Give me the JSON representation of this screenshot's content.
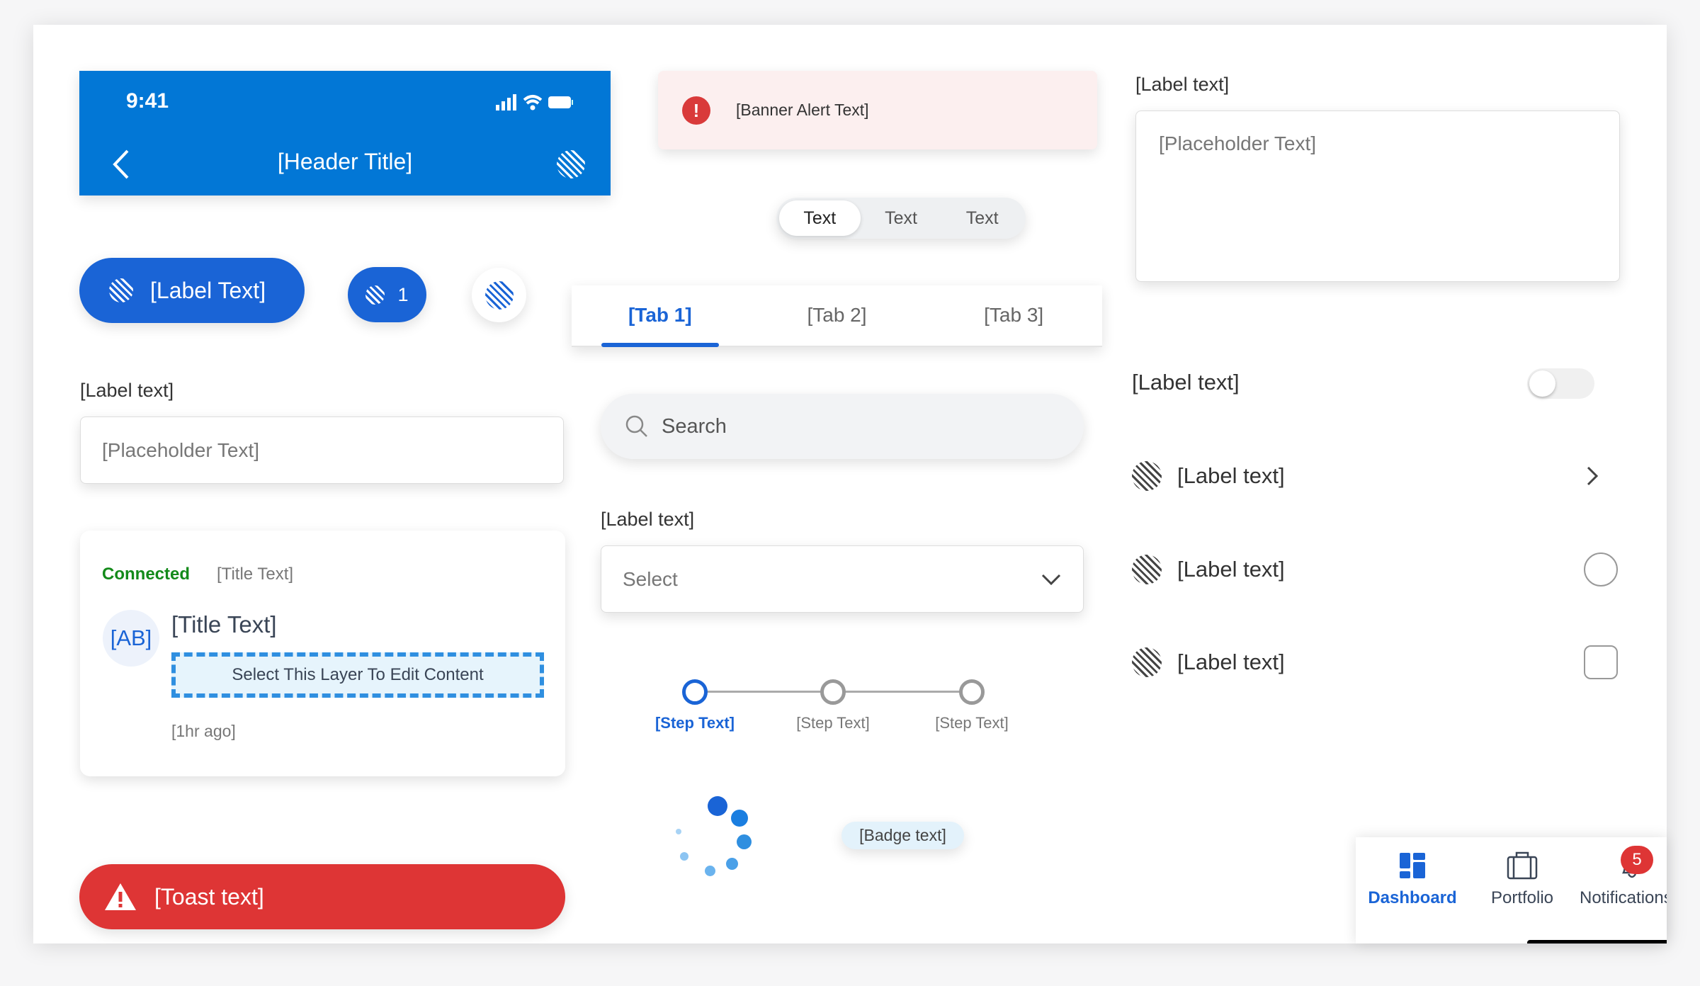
{
  "header": {
    "time": "9:41",
    "title": "[Header Title]"
  },
  "banner": {
    "text": "[Banner Alert Text]"
  },
  "segmented": [
    "Text",
    "Text",
    "Text"
  ],
  "tabs": [
    "[Tab 1]",
    "[Tab 2]",
    "[Tab 3]"
  ],
  "textarea": {
    "label": "[Label text]",
    "placeholder": "[Placeholder Text]"
  },
  "buttons": {
    "primary_label": "[Label Text]",
    "count": "1"
  },
  "input": {
    "label": "[Label text]",
    "placeholder": "[Placeholder Text]"
  },
  "card": {
    "status": "Connected",
    "subtitle": "[Title Text]",
    "avatar": "[AB]",
    "title": "[Title Text]",
    "layer": "Select This Layer To Edit Content",
    "time": "[1hr ago]"
  },
  "toast": {
    "text": "[Toast text]"
  },
  "search": {
    "placeholder": "Search"
  },
  "select": {
    "label": "[Label text]",
    "value": "Select"
  },
  "stepper": {
    "steps": [
      "[Step Text]",
      "[Step Text]",
      "[Step Text]"
    ],
    "active": 0
  },
  "badge": {
    "text": "[Badge text]"
  },
  "toggle": {
    "label": "[Label text]",
    "on": false
  },
  "list": [
    "[Label text]",
    "[Label text]",
    "[Label text]"
  ],
  "bottom_nav": {
    "items": [
      "Dashboard",
      "Portfolio",
      "Notifications"
    ],
    "active": 0,
    "notification_count": "5"
  },
  "colors": {
    "primary": "#1a64d6",
    "header": "#0277d6",
    "error": "#de3535",
    "success": "#138a1a"
  }
}
